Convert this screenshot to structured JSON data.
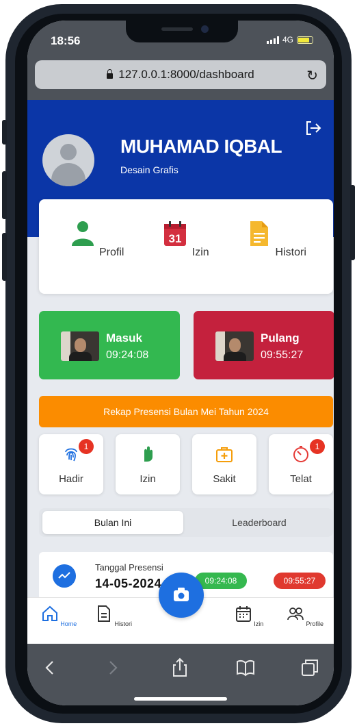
{
  "status_bar": {
    "time": "18:56",
    "network": "4G"
  },
  "browser": {
    "url": "127.0.0.1:8000/dashboard"
  },
  "user": {
    "name": "MUHAMAD IQBAL",
    "role": "Desain Grafis"
  },
  "menu": [
    {
      "label": "Profil",
      "icon": "person-icon",
      "color": "#2e9e4f"
    },
    {
      "label": "Izin",
      "icon": "calendar-icon",
      "color": "#d32f3f",
      "calendar_day": "31"
    },
    {
      "label": "Histori",
      "icon": "document-icon",
      "color": "#f5b82e"
    }
  ],
  "attendance": {
    "masuk": {
      "label": "Masuk",
      "time": "09:24:08",
      "color": "#33b850"
    },
    "pulang": {
      "label": "Pulang",
      "time": "09:55:27",
      "color": "#c4213d"
    }
  },
  "rekap_title": "Rekap Presensi Bulan Mei Tahun 2024",
  "stats": [
    {
      "label": "Hadir",
      "badge": "1",
      "icon": "fingerprint-icon",
      "color": "#1e6fe0"
    },
    {
      "label": "Izin",
      "badge": "",
      "icon": "hand-icon",
      "color": "#2e9e4f"
    },
    {
      "label": "Sakit",
      "badge": "",
      "icon": "medical-kit-icon",
      "color": "#f59e0b"
    },
    {
      "label": "Telat",
      "badge": "1",
      "icon": "timer-icon",
      "color": "#e53935"
    }
  ],
  "tabs": {
    "current": "Bulan Ini",
    "other": "Leaderboard"
  },
  "record": {
    "label": "Tanggal Presensi",
    "date": "14-05-2024",
    "time_in": "09:24:08",
    "time_out": "09:55:27"
  },
  "bottom_nav": {
    "home": "Home",
    "histori": "Histori",
    "izin": "Izin",
    "profile": "Profile"
  }
}
